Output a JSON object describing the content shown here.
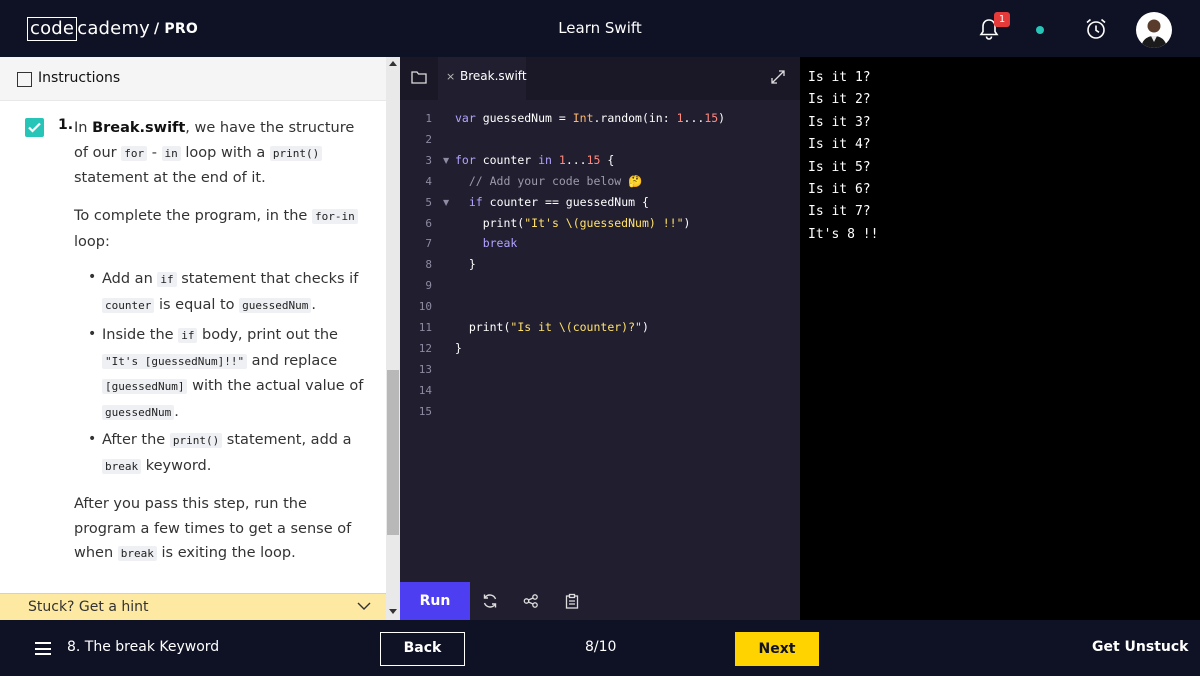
{
  "header": {
    "logo_part1": "code",
    "logo_part2": "cademy",
    "logo_pro": "/ PRO",
    "title": "Learn Swift",
    "notification_count": "1",
    "status_dot_color": "#27c5b8"
  },
  "instructions": {
    "header_label": "Instructions",
    "step_number": "1.",
    "step_text": {
      "a": "In ",
      "b": "Break.swift",
      "c": ", we have the structure of our ",
      "code1": "for",
      "d": " - ",
      "code2": "in",
      "e": " loop with a ",
      "code3": "print()",
      "f": " statement at the end of it."
    },
    "para2": {
      "a": "To complete the program, in the ",
      "code": "for-in",
      "b": " loop:"
    },
    "bullet1": {
      "a": "Add an ",
      "code1": "if",
      "b": " statement that checks if ",
      "code2": "counter",
      "c": " is equal to ",
      "code3": "guessedNum",
      "d": "."
    },
    "bullet2": {
      "a": "Inside the ",
      "code1": "if",
      "b": " body, print out the ",
      "code2": "\"It's [guessedNum]!!\"",
      "c": " and replace ",
      "code3": "[guessedNum]",
      "d": " with the actual value of ",
      "code4": "guessedNum",
      "e": "."
    },
    "bullet3": {
      "a": "After the ",
      "code1": "print()",
      "b": " statement, add a ",
      "code2": "break",
      "c": " keyword."
    },
    "para3": {
      "a": "After you pass this step, run the program a few times to get a sense of when ",
      "code": "break",
      "b": " is exiting the loop."
    },
    "hint": "Stuck? Get a hint"
  },
  "editor": {
    "tab_close": "×",
    "tab_name": "Break.swift",
    "line_numbers": [
      "1",
      "2",
      "3",
      "4",
      "5",
      "6",
      "7",
      "8",
      "9",
      "10",
      "11",
      "12",
      "13",
      "14",
      "15"
    ],
    "run_label": "Run"
  },
  "output": {
    "lines": [
      "Is it 1?",
      "Is it 2?",
      "Is it 3?",
      "Is it 4?",
      "Is it 5?",
      "Is it 6?",
      "Is it 7?",
      "It's 8 !!"
    ]
  },
  "footer": {
    "lesson": "8. The break Keyword",
    "back": "Back",
    "progress": "8/10",
    "next": "Next",
    "unstuck": "Get Unstuck"
  }
}
